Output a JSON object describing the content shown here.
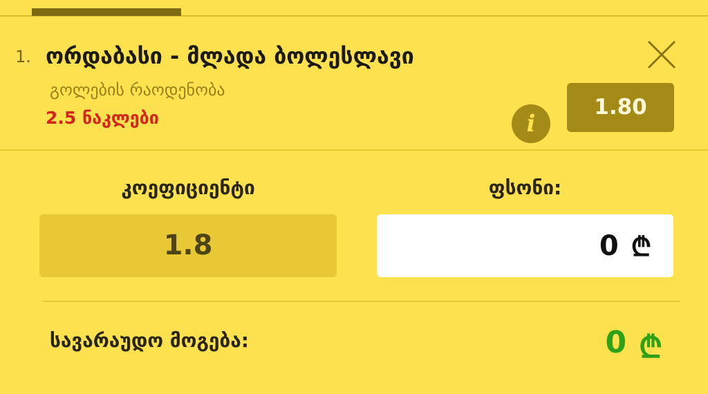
{
  "event": {
    "index": "1.",
    "title": "ორდაბასი - მლადა ბოლესლავი",
    "market": "გოლების რაოდენობა",
    "selection": "2.5 ნაკლები",
    "odd": "1.80",
    "info_icon": "i"
  },
  "form": {
    "coefficient_label": "კოეფიციენტი",
    "coefficient_value": "1.8",
    "stake_label": "ფსონი:",
    "stake_value": "0",
    "stake_currency": "₾"
  },
  "potential": {
    "label": "სავარაუდო მოგება:",
    "value": "0",
    "currency": "₾"
  },
  "colors": {
    "background": "#fde14f",
    "accent_dark": "#a48b17",
    "selection_red": "#d4271c",
    "win_green": "#2ea117"
  }
}
